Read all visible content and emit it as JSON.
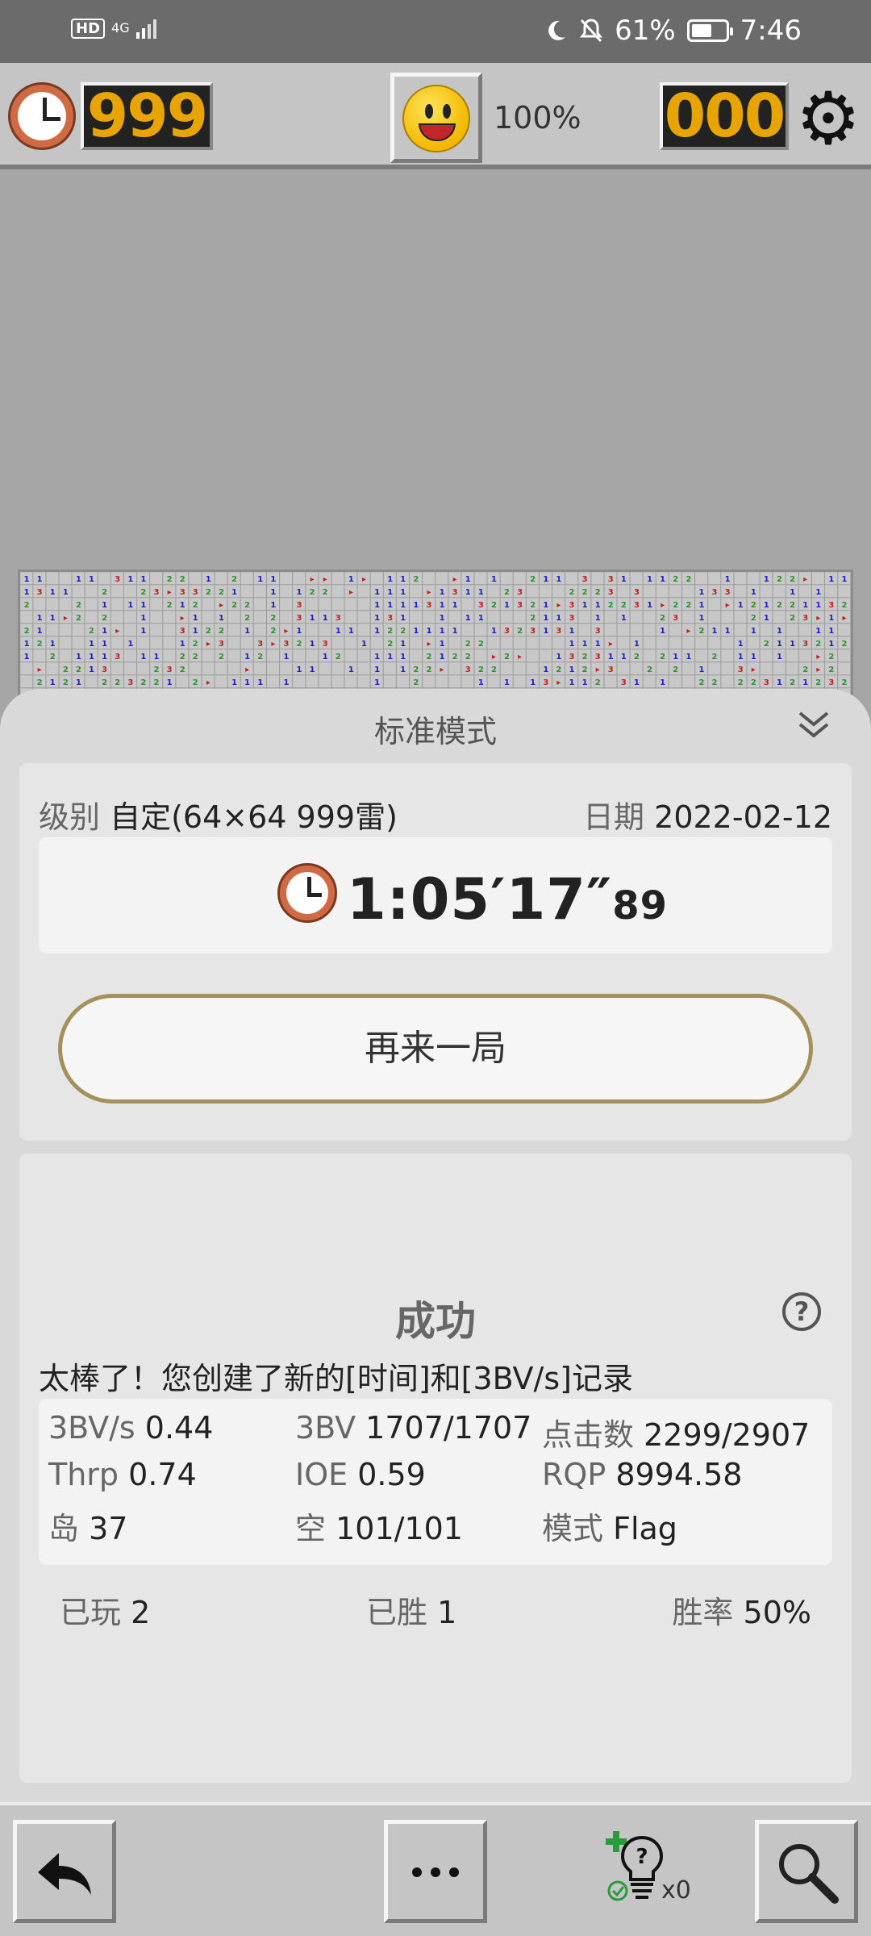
{
  "status_bar": {
    "hd": "HD",
    "network": "4G",
    "battery": "61%",
    "battery_level": 0.61,
    "time": "7:46",
    "icons": [
      "moon-icon",
      "bell-muted-icon",
      "battery-icon",
      "signal-icon"
    ]
  },
  "toolbar": {
    "timer_value": "999",
    "percent": "100%",
    "mines_value": "000",
    "icons": [
      "clock-icon",
      "smiley-face-icon",
      "gear-icon"
    ]
  },
  "sheet": {
    "title": "标准模式",
    "level_label": "级别",
    "level_value": "自定(64×64  999雷)",
    "date_label": "日期",
    "date_value": "2022-02-12",
    "time_main": "1:05′17″",
    "time_cs": "89",
    "play_again": "再来一局",
    "result_title": "成功",
    "result_message": "太棒了！您创建了新的[时间]和[3BV/s]记录",
    "stats": [
      {
        "label": "3BV/s",
        "value": "0.44"
      },
      {
        "label": "3BV",
        "value": "1707/1707"
      },
      {
        "label": "点击数",
        "value": "2299/2907"
      },
      {
        "label": "Thrp",
        "value": "0.74"
      },
      {
        "label": "IOE",
        "value": "0.59"
      },
      {
        "label": "RQP",
        "value": "8994.58"
      },
      {
        "label": "岛",
        "value": "37"
      },
      {
        "label": "空",
        "value": "101/101"
      },
      {
        "label": "模式",
        "value": "Flag"
      }
    ],
    "played_label": "已玩",
    "played_value": "2",
    "won_label": "已胜",
    "won_value": "1",
    "winrate_label": "胜率",
    "winrate_value": "50%"
  },
  "bottom_nav": {
    "hint_count": "x0",
    "icons": [
      "back-arrow-icon",
      "more-dots-icon",
      "hint-bulb-icon",
      "magnifier-icon"
    ]
  },
  "colors": {
    "led_digits": "#e8a400",
    "button_border": "#a3905a",
    "num1": "#2020c0",
    "num2": "#2f8f2f",
    "num3": "#c02020",
    "num4": "#20207a"
  }
}
